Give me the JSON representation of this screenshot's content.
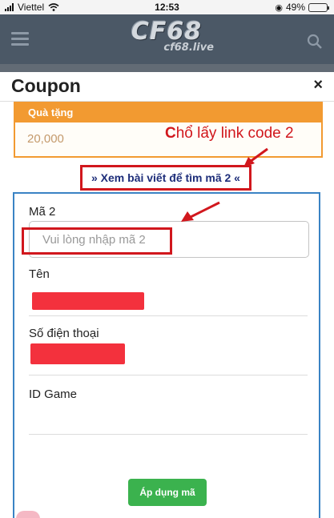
{
  "status_bar": {
    "carrier": "Viettel",
    "time": "12:53",
    "battery": "49%",
    "battery_level": 0.49
  },
  "app_header": {
    "logo_main": "CF68",
    "logo_sub": "cf68.live"
  },
  "modal": {
    "title": "Coupon",
    "close": "×"
  },
  "gift": {
    "label": "Quà tặng",
    "value": "20,000"
  },
  "annotation": {
    "first": "C",
    "rest": "hổ lấy link code 2"
  },
  "view_link": "» Xem bài viết để tìm mã 2 «",
  "form": {
    "code_label": "Mã 2",
    "code_placeholder": "Vui lòng nhập mã 2",
    "name_label": "Tên",
    "phone_label": "Số điện thoại",
    "game_id_label": "ID Game"
  },
  "apply_button": "Áp dụng mã",
  "colors": {
    "accent_orange": "#f29a31",
    "form_border": "#3a83c4",
    "annotation_red": "#d1171d",
    "button_green": "#3bb24e"
  }
}
